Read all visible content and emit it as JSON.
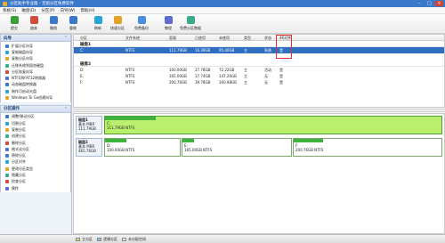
{
  "window": {
    "title": "分区助手专业版 - 无损分区免费软件",
    "min": "–",
    "max": "□",
    "close": "×"
  },
  "menu": [
    "系统(S)",
    "磁盘(D)",
    "分区(P)",
    "向导(W)",
    "帮助(H)"
  ],
  "toolbar": [
    {
      "label": "提交",
      "icon": "commit-icon",
      "color": "#3a9f3a"
    },
    {
      "label": "放弃",
      "icon": "discard-icon",
      "color": "#d24b3b"
    },
    {
      "label": "撤销",
      "icon": "undo-icon",
      "color": "#3a78c9"
    },
    {
      "label": "重做",
      "icon": "redo-icon",
      "color": "#3a78c9"
    },
    {
      "label": "刷新",
      "icon": "refresh-icon",
      "color": "#2aa6d6"
    },
    {
      "label": "快速分区",
      "icon": "quick-partition-icon",
      "color": "#e3a22a"
    },
    {
      "label": "免费备份",
      "icon": "backup-icon",
      "color": "#4b8de0"
    },
    {
      "label": "教程",
      "icon": "tutorial-icon",
      "color": "#5b6bd1"
    },
    {
      "label": "免费分区数据",
      "icon": "recovery-icon",
      "color": "#39a98b"
    }
  ],
  "sidebar": {
    "wizard_title": "向导",
    "wizard_items": [
      "扩展分区向导",
      "复制磁盘向导",
      "复制分区向导",
      "迁移系统到固态硬盘",
      "分区恢复向导",
      "NTFS到FAT32转换器",
      "动态磁盘转换器",
      "制作可启动光盘",
      "Windows To Go创建向导"
    ],
    "ops_title": "分区操作",
    "ops_items": [
      "调整/移动分区",
      "切割分区",
      "复制分区",
      "创建分区",
      "删除分区",
      "格式化分区",
      "擦除分区",
      "分区对齐",
      "更改分区类型",
      "隐藏分区",
      "检查分区",
      "属性"
    ]
  },
  "table": {
    "columns": [
      "分区",
      "文件系统",
      "容量",
      "已使用",
      "未使用",
      "类型",
      "状态",
      "4K对齐"
    ],
    "groups": [
      {
        "name": "磁盘1",
        "rows": [
          {
            "partition": "C:",
            "fs": "NTFS",
            "capacity": "111.79GB",
            "used": "16.39GB",
            "free": "95.40GB",
            "type": "主",
            "status": "系统",
            "align": "是",
            "selected": true
          }
        ]
      },
      {
        "name": "磁盘2",
        "rows": [
          {
            "partition": "D:",
            "fs": "NTFS",
            "capacity": "100.00GB",
            "used": "27.78GB",
            "free": "72.22GB",
            "type": "主",
            "status": "活动",
            "align": "是",
            "selected": false
          },
          {
            "partition": "E:",
            "fs": "NTFS",
            "capacity": "165.00GB",
            "used": "17.74GB",
            "free": "147.26GB",
            "type": "主",
            "status": "无",
            "align": "是",
            "selected": false
          },
          {
            "partition": "F:",
            "fs": "NTFS",
            "capacity": "200.76GB",
            "used": "39.78GB",
            "free": "160.98GB",
            "type": "主",
            "status": "无",
            "align": "是",
            "selected": false
          }
        ]
      }
    ]
  },
  "disk_map": [
    {
      "name": "磁盘1",
      "kind": "基本 MBR",
      "size": "111.79GB",
      "partitions": [
        {
          "letter": "C:",
          "desc": "111.79GB NTFS",
          "usage": 0.15,
          "full": true
        }
      ]
    },
    {
      "name": "磁盘2",
      "kind": "基本 MBR",
      "size": "465.76GB",
      "partitions": [
        {
          "letter": "D:",
          "desc": "100.00GB NTFS",
          "usage": 0.28,
          "full": false
        },
        {
          "letter": "E:",
          "desc": "165.00GB NTFS",
          "usage": 0.11,
          "full": false
        },
        {
          "letter": "F:",
          "desc": "200.76GB NTFS",
          "usage": 0.2,
          "full": false
        }
      ]
    }
  ],
  "legend": [
    {
      "label": "主分区",
      "color": "#b9ef6d"
    },
    {
      "label": "逻辑分区",
      "color": "#7fc8f8"
    },
    {
      "label": "未分配空间",
      "color": "#e6e6e6"
    }
  ]
}
